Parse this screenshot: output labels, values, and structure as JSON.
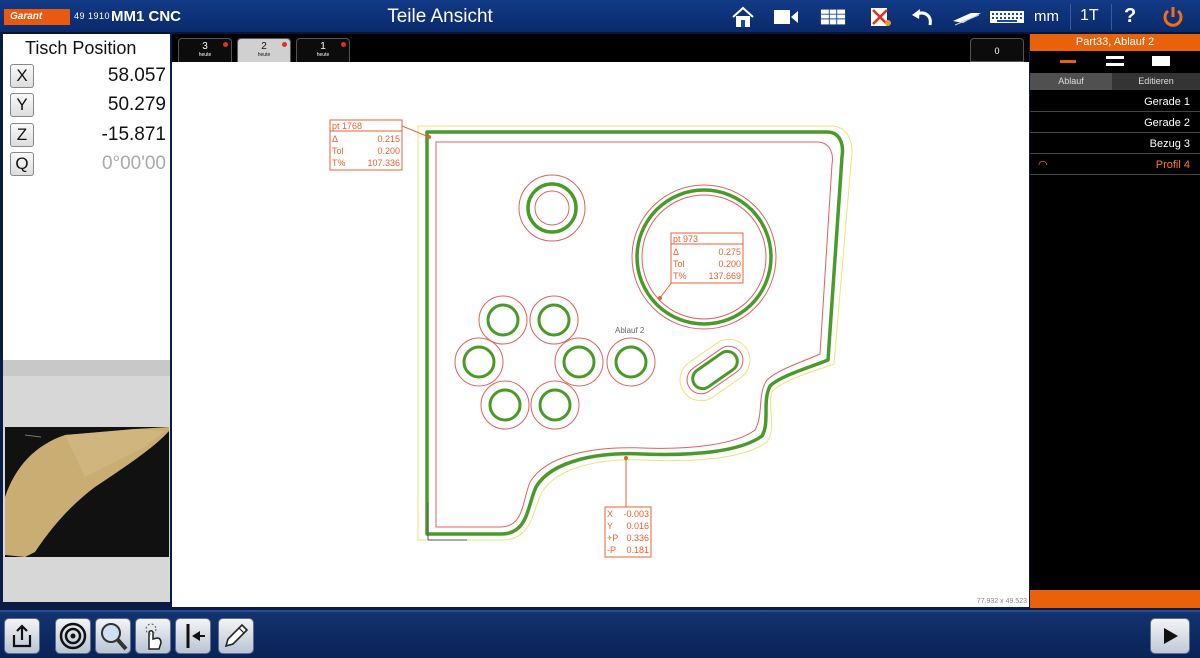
{
  "app": {
    "brand": "Garant",
    "brand_number": "49 1910",
    "product": "MM1 CNC",
    "title": "Teile Ansicht",
    "units": "mm",
    "tool": "1T",
    "help": "?"
  },
  "toolbar_icons": [
    "home-icon",
    "video-icon",
    "table-icon",
    "reject-icon",
    "undo-icon",
    "lightpen-icon",
    "keyboard-icon",
    "power-icon"
  ],
  "position": {
    "title": "Tisch Position",
    "axes": [
      {
        "label": "X",
        "value": "58.057"
      },
      {
        "label": "Y",
        "value": "50.279"
      },
      {
        "label": "Z",
        "value": "-15.871"
      },
      {
        "label": "Q",
        "value": "0°00'00"
      }
    ]
  },
  "view_tabs": [
    {
      "num": "3",
      "sub": "heute"
    },
    {
      "num": "2",
      "sub": "heute"
    },
    {
      "num": "1",
      "sub": "heute"
    }
  ],
  "view_tab_count": "0",
  "canvas": {
    "annotation_pt1": {
      "title": "pt 1768",
      "rows": [
        [
          "Δ",
          "0.215"
        ],
        [
          "Tol",
          "0.200"
        ],
        [
          "T%",
          "107.336"
        ]
      ]
    },
    "annotation_pt2": {
      "title": "pt 973",
      "rows": [
        [
          "Δ",
          "0.275"
        ],
        [
          "Tol",
          "0.200"
        ],
        [
          "T%",
          "137.669"
        ]
      ]
    },
    "annotation_xy": {
      "rows": [
        [
          "X",
          "-0.003"
        ],
        [
          "Y",
          "0.016"
        ],
        [
          "+P",
          "0.336"
        ],
        [
          "-P",
          "0.181"
        ]
      ]
    },
    "label_ablauf": "Ablauf 2",
    "size_readout": "77.932 x 49.523"
  },
  "sequence": {
    "header": "Part33, Ablauf 2",
    "tabs": [
      "Ablauf",
      "Editieren"
    ],
    "steps": [
      {
        "label": "Gerade 1",
        "active": false
      },
      {
        "label": "Gerade 2",
        "active": false
      },
      {
        "label": "Bezug 3",
        "active": false
      },
      {
        "label": "Profil 4",
        "active": true
      }
    ]
  },
  "colors": {
    "accent": "#e8620c",
    "topbar": "#123a86",
    "profile_green": "#4a9a2a",
    "tolerance_red": "#e06060",
    "tolerance_yellow": "#f0e070",
    "annotation": "#e86030"
  },
  "bottom_buttons": [
    "export-icon",
    "target-icon",
    "magnifier-icon",
    "touch-icon",
    "probe-icon",
    "pen-icon",
    "play-icon"
  ]
}
